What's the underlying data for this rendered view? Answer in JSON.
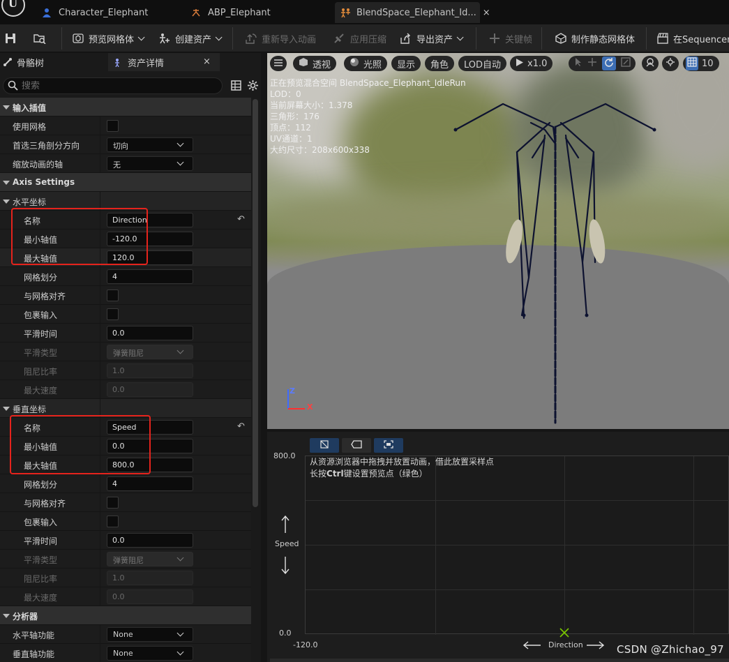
{
  "tabs": [
    {
      "label": "Character_Elephant",
      "icon": "person-icon",
      "active": false
    },
    {
      "label": "ABP_Elephant",
      "icon": "anim-blueprint-icon",
      "active": false
    },
    {
      "label": "BlendSpace_Elephant_Id...",
      "icon": "blendspace-icon",
      "active": true,
      "close": "×"
    }
  ],
  "toolbar": {
    "preview_mesh": "预览网格体",
    "create_asset": "创建资产",
    "reimport": "重新导入动画",
    "apply_compression": "应用压缩",
    "export_asset": "导出资产",
    "keyframe": "关键帧",
    "make_static_mesh": "制作静态网格体",
    "in_sequencer": "在Sequencer中"
  },
  "panel_tabs": {
    "skeleton_tree": "骨骼树",
    "asset_details": "资产详情",
    "close": "×"
  },
  "search": {
    "placeholder": "搜索"
  },
  "props": {
    "input_interp": {
      "header": "输入插值",
      "use_grid": "使用网格",
      "tri_dir": "首选三角剖分方向",
      "tri_dir_value": "切向",
      "scale_axis": "缩放动画的轴",
      "scale_axis_value": "无"
    },
    "axis_settings": "Axis Settings",
    "horizontal": {
      "header": "水平坐标",
      "name_label": "名称",
      "name": "Direction",
      "min_label": "最小轴值",
      "min": "-120.0",
      "max_label": "最大轴值",
      "max": "120.0",
      "div_label": "网格划分",
      "div": "4",
      "snap_label": "与网格对齐",
      "wrap_label": "包裹输入",
      "smooth_label": "平滑时间",
      "smooth": "0.0",
      "smooth_type_label": "平滑类型",
      "smooth_type": "弹簧阻尼",
      "damping_label": "阻尼比率",
      "damping": "1.0",
      "maxspeed_label": "最大速度",
      "maxspeed": "0.0"
    },
    "vertical": {
      "header": "垂直坐标",
      "name_label": "名称",
      "name": "Speed",
      "min_label": "最小轴值",
      "min": "0.0",
      "max_label": "最大轴值",
      "max": "800.0",
      "div_label": "网格划分",
      "div": "4",
      "snap_label": "与网格对齐",
      "wrap_label": "包裹输入",
      "smooth_label": "平滑时间",
      "smooth": "0.0",
      "smooth_type_label": "平滑类型",
      "smooth_type": "弹簧阻尼",
      "damping_label": "阻尼比率",
      "damping": "1.0",
      "maxspeed_label": "最大速度",
      "maxspeed": "0.0"
    },
    "analyzer": {
      "header": "分析器",
      "h_func_label": "水平轴功能",
      "h_func": "None",
      "v_func_label": "垂直轴功能",
      "v_func": "None"
    }
  },
  "viewport": {
    "menu_icon": "hamburger-icon",
    "perspective": "透视",
    "lit": "光照",
    "show": "显示",
    "character": "角色",
    "lod": "LOD自动",
    "speed": "x1.0",
    "grid_value": "10",
    "stats": {
      "previewing": "正在预览混合空间 BlendSpace_Elephant_IdleRun",
      "lod": "LOD：0",
      "screen_size": "当前屏幕大小：1.378",
      "triangles": "三角形：176",
      "vertices": "顶点：112",
      "uv": "UV通道：1",
      "approx_size": "大约尺寸：208x600x338"
    },
    "axis_z": "Z",
    "axis_x": "X"
  },
  "blendspace": {
    "y_max": "800.0",
    "y_min": "0.0",
    "x_min": "-120.0",
    "y_axis": "Speed",
    "x_axis": "Direction",
    "hint1": "从资源浏览器中拖拽并放置动画，借此放置采样点",
    "hint2_pre": "长按",
    "hint2_key": "Ctrl",
    "hint2_post": "键设置预览点（绿色）"
  },
  "watermark": "CSDN @Zhichao_97",
  "colors": {
    "highlight_red": "#e5231c",
    "skeleton": "#0d1230",
    "preview_point": "#7ac800"
  }
}
